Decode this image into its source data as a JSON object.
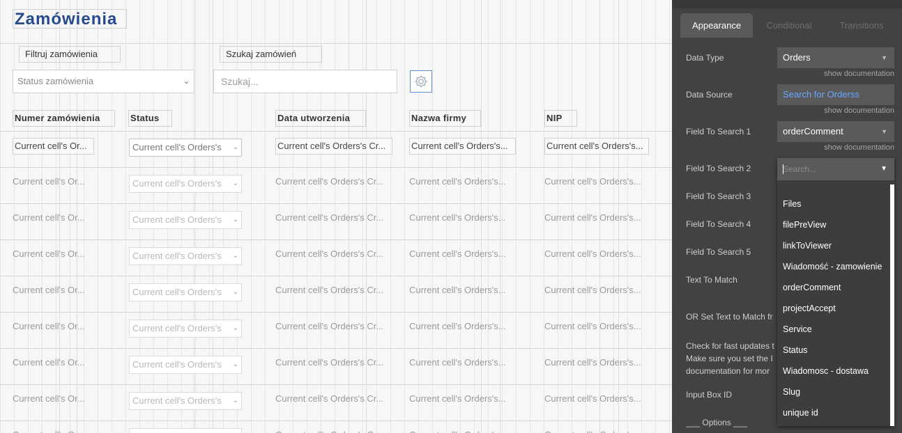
{
  "page": {
    "title": "Zamówienia",
    "filter_label": "Filtruj zamówienia",
    "search_label": "Szukaj zamówień",
    "status_select_placeholder": "Status zamówienia",
    "search_placeholder": "Szukaj..."
  },
  "table": {
    "headers": [
      "Numer zamówienia",
      "Status",
      "Data utworzenia",
      "Nazwa firmy",
      "NIP"
    ],
    "cell_texts": {
      "order_number": "Current cell's Or...",
      "status": "Current cell's Orders's",
      "created": "Current cell's Orders's Cr...",
      "company": "Current cell's Orders's...",
      "nip": "Current cell's Orders's..."
    },
    "row_count": 9
  },
  "panel": {
    "tabs": [
      "Appearance",
      "Conditional",
      "Transitions"
    ],
    "active_tab": "Appearance",
    "data_type_label": "Data Type",
    "data_type_value": "Orders",
    "data_source_label": "Data Source",
    "data_source_value": "Search for Orderss",
    "show_documentation": "show documentation",
    "field1_label": "Field To Search 1",
    "field1_value": "orderComment",
    "field2_label": "Field To Search 2",
    "field2_placeholder": "Search...",
    "field3_label": "Field To Search 3",
    "field4_label": "Field To Search 4",
    "field5_label": "Field To Search 5",
    "text_to_match_label": "Text To Match",
    "or_set_label": "OR Set Text to Match fr",
    "check_line1": "Check for fast updates t",
    "check_line2": "Make sure you set the I",
    "check_line3": "documentation for mor",
    "input_box_id_label": "Input Box ID",
    "options_label": "___ Options ___"
  },
  "dropdown_options": [
    "Files",
    "filePreView",
    "linkToViewer",
    "Wiadomość - zamowienie",
    "orderComment",
    "projectAccept",
    "Service",
    "Status",
    "Wiadomosc - dostawa",
    "Slug",
    "unique id"
  ],
  "colors": {
    "title": "#274a8d",
    "panel_bg": "#424242",
    "panel_field": "#5a5a5a",
    "link": "#6aa6ff",
    "gear_border": "#5c8fd6"
  }
}
